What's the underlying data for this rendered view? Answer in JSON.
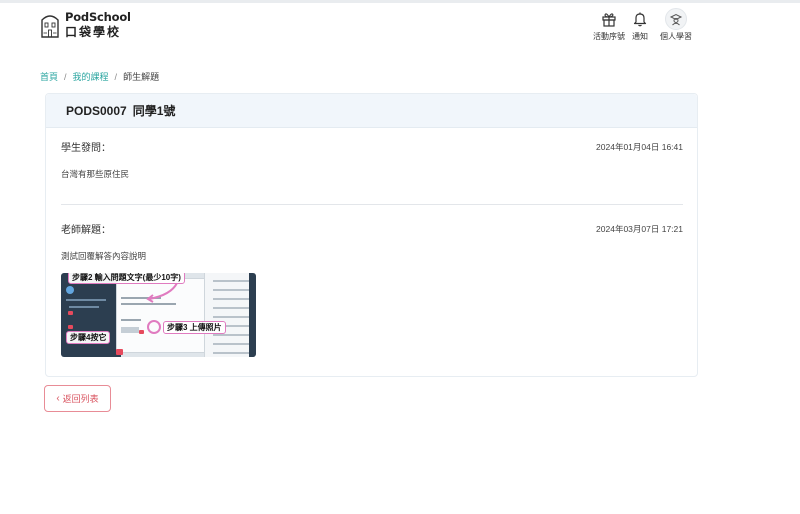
{
  "brand": {
    "name_en": "PodSchool",
    "name_zh": "口袋學校"
  },
  "nav": {
    "items": [
      {
        "label": "活動序號",
        "icon": "gift-icon"
      },
      {
        "label": "通知",
        "icon": "bell-icon"
      },
      {
        "label": "個人學習",
        "icon": "user-avatar-icon"
      }
    ]
  },
  "breadcrumb": {
    "home": "首頁",
    "courses": "我的課程",
    "current": "師生解題",
    "separator": "/"
  },
  "question": {
    "id": "PODS0007",
    "student_name": "同學1號",
    "student": {
      "label": "學生發問：",
      "time": "2024年01月04日 16:41",
      "text": "台灣有那些原住民"
    },
    "teacher": {
      "label": "老師解題：",
      "time": "2024年03月07日 17:21",
      "text": "測試回覆解答內容說明"
    },
    "attachment": {
      "annotations": {
        "step2": "步驟2 輸入問題文字(最少10字)",
        "step3": "步驟3 上傳照片",
        "step4": "步驟4按它"
      }
    }
  },
  "back_button": {
    "label": "返回列表"
  },
  "colors": {
    "accent": "#2aa5a0",
    "danger": "#d9535f",
    "annotation": "#e07bc0",
    "header_bg": "#f1f6fb"
  }
}
